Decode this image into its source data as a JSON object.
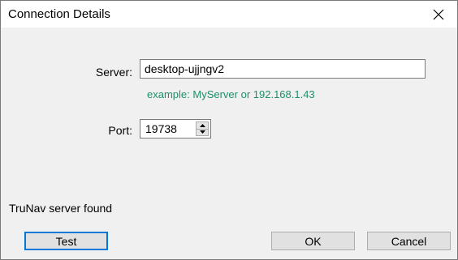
{
  "window": {
    "title": "Connection Details",
    "close_icon": "close-icon"
  },
  "form": {
    "server_label": "Server:",
    "server_value": "desktop-ujjngv2",
    "server_hint": "example: MyServer or 192.168.1.43",
    "port_label": "Port:",
    "port_value": "19738"
  },
  "status": {
    "text": "TruNav server found"
  },
  "buttons": {
    "test": "Test",
    "ok": "OK",
    "cancel": "Cancel"
  },
  "colors": {
    "hint": "#1f8f6a",
    "focus_border": "#0078d7"
  }
}
